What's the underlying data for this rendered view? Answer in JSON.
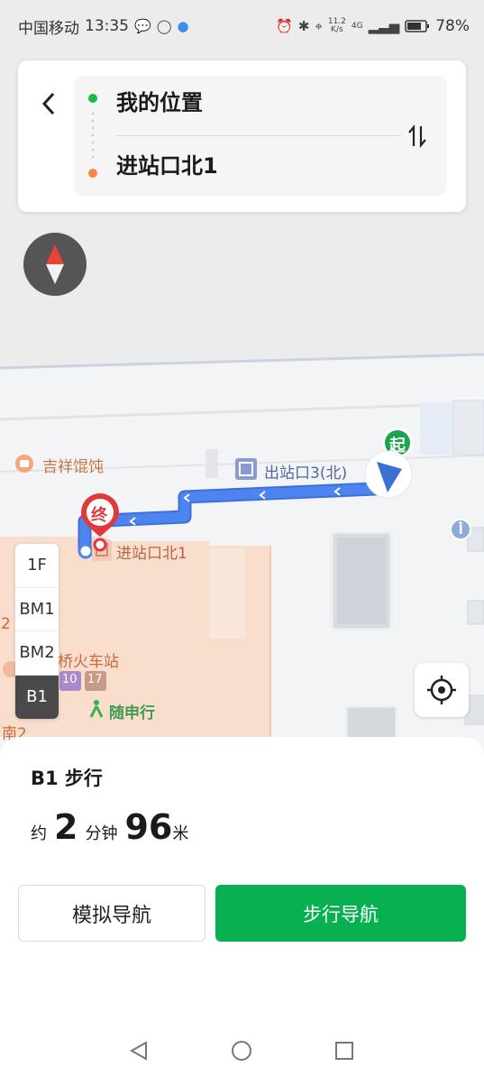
{
  "status_bar": {
    "carrier": "中国移动",
    "time": "13:35",
    "net_speed_value": "11.2",
    "net_speed_unit": "K/s",
    "signal_type": "4G",
    "battery": "78%"
  },
  "route": {
    "start": "我的位置",
    "end": "进站口北1"
  },
  "map": {
    "labels": {
      "shop": "吉祥馄饨",
      "exit": "出站口3(北)",
      "entrance": "进站口北1",
      "station": "桥火车站",
      "service": "随申行",
      "south": "南2",
      "partial_number": "2",
      "line_a": "10",
      "line_b": "17"
    },
    "markers": {
      "start": "起",
      "end": "终"
    }
  },
  "floors": [
    "1F",
    "BM1",
    "BM2",
    "B1"
  ],
  "active_floor": "B1",
  "summary": {
    "mode": "B1 步行",
    "approx": "约",
    "minutes": "2",
    "minutes_unit": "分钟",
    "distance": "96",
    "distance_unit": "米"
  },
  "buttons": {
    "simulate": "模拟导航",
    "walk": "步行导航"
  },
  "colors": {
    "route": "#4a7ee8",
    "accent": "#07b152",
    "start_dot": "#22b54b",
    "end_dot": "#f6894a",
    "end_marker": "#e0393c"
  }
}
